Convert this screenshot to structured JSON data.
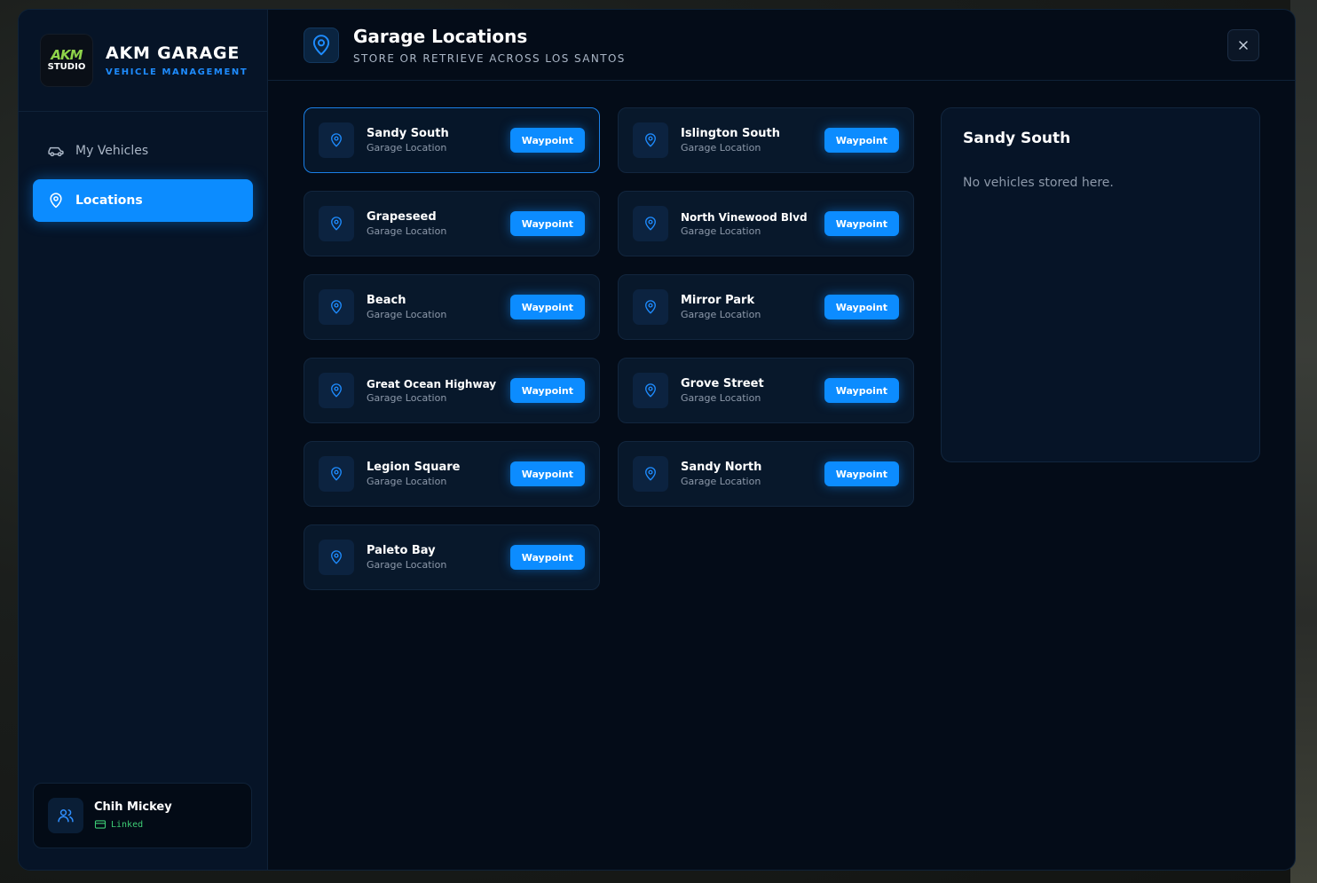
{
  "brand": {
    "logo_mark": "AKM",
    "logo_text": "STUDIO",
    "title": "AKM GARAGE",
    "subtitle": "VEHICLE MANAGEMENT"
  },
  "nav": {
    "items": [
      {
        "label": "My Vehicles",
        "icon": "car-icon",
        "active": false
      },
      {
        "label": "Locations",
        "icon": "map-pin-icon",
        "active": true
      }
    ]
  },
  "user": {
    "name": "Chih Mickey",
    "status": "Linked"
  },
  "header": {
    "title": "Garage Locations",
    "subtitle": "STORE OR RETRIEVE ACROSS LOS SANTOS",
    "close_icon": "close-icon"
  },
  "locations": [
    {
      "name": "Sandy South",
      "sub": "Garage Location",
      "button": "Waypoint",
      "selected": true
    },
    {
      "name": "Islington South",
      "sub": "Garage Location",
      "button": "Waypoint"
    },
    {
      "name": "Grapeseed",
      "sub": "Garage Location",
      "button": "Waypoint"
    },
    {
      "name": "North Vinewood Blvd",
      "sub": "Garage Location",
      "button": "Waypoint"
    },
    {
      "name": "Beach",
      "sub": "Garage Location",
      "button": "Waypoint"
    },
    {
      "name": "Mirror Park",
      "sub": "Garage Location",
      "button": "Waypoint"
    },
    {
      "name": "Great Ocean Highway",
      "sub": "Garage Location",
      "button": "Waypoint"
    },
    {
      "name": "Grove Street",
      "sub": "Garage Location",
      "button": "Waypoint"
    },
    {
      "name": "Legion Square",
      "sub": "Garage Location",
      "button": "Waypoint"
    },
    {
      "name": "Sandy North",
      "sub": "Garage Location",
      "button": "Waypoint"
    },
    {
      "name": "Paleto Bay",
      "sub": "Garage Location",
      "button": "Waypoint"
    }
  ],
  "detail": {
    "title": "Sandy South",
    "empty_text": "No vehicles stored here."
  },
  "colors": {
    "accent": "#0c8cff",
    "background": "#040c18",
    "sidebar": "#061427",
    "linked": "#3ecf76"
  }
}
